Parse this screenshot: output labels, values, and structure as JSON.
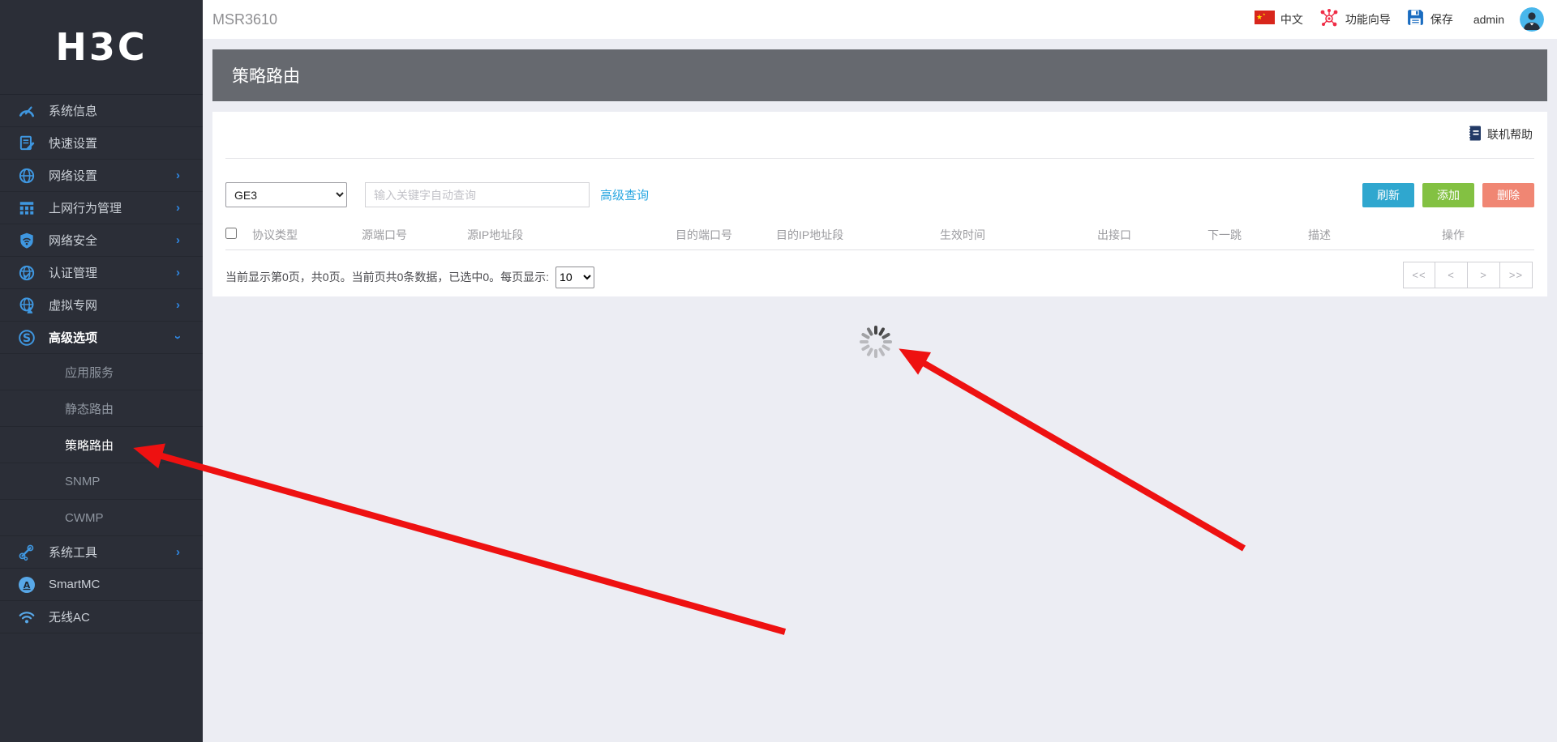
{
  "sidebar": {
    "logo": "H3C",
    "items": [
      {
        "label": "系统信息",
        "icon": "gauge-icon"
      },
      {
        "label": "快速设置",
        "icon": "quick-setup-icon"
      },
      {
        "label": "网络设置",
        "icon": "globe-icon",
        "chevron": "right"
      },
      {
        "label": "上网行为管理",
        "icon": "behavior-icon",
        "chevron": "right"
      },
      {
        "label": "网络安全",
        "icon": "shield-icon",
        "chevron": "right"
      },
      {
        "label": "认证管理",
        "icon": "auth-globe-icon",
        "chevron": "right"
      },
      {
        "label": "虚拟专网",
        "icon": "vpn-globe-icon",
        "chevron": "right"
      },
      {
        "label": "高级选项",
        "icon": "advanced-icon",
        "chevron": "down",
        "expanded": true
      },
      {
        "label": "应用服务",
        "sub": true
      },
      {
        "label": "静态路由",
        "sub": true
      },
      {
        "label": "策略路由",
        "sub": true,
        "selected": true
      },
      {
        "label": "SNMP",
        "sub": true
      },
      {
        "label": "CWMP",
        "sub": true
      },
      {
        "label": "系统工具",
        "icon": "tools-icon",
        "chevron": "right"
      },
      {
        "label": "SmartMC",
        "icon": "smartmc-icon"
      },
      {
        "label": "无线AC",
        "icon": "wifi-icon"
      }
    ]
  },
  "header": {
    "device": "MSR3610",
    "language": "中文",
    "wizard": "功能向导",
    "save": "保存",
    "username": "admin"
  },
  "page": {
    "title": "策略路由",
    "help": "联机帮助"
  },
  "toolbar": {
    "interface_value": "GE3",
    "search_placeholder": "输入关键字自动查询",
    "advanced_query": "高级查询",
    "refresh": "刷新",
    "add": "添加",
    "delete": "删除"
  },
  "table": {
    "columns": [
      "协议类型",
      "源端口号",
      "源IP地址段",
      "目的端口号",
      "目的IP地址段",
      "生效时间",
      "出接口",
      "下一跳",
      "描述",
      "操作"
    ]
  },
  "pagination": {
    "summary": "当前显示第0页，共0页。当前页共0条数据，已选中0。每页显示:",
    "page_size": "10",
    "first": "<<",
    "prev": "<",
    "next": ">",
    "last": ">>"
  },
  "colors": {
    "refresh_button": "#2fa7cf",
    "add_button": "#83c142",
    "delete_button": "#f08673",
    "link": "#2aa7e1",
    "annotation_arrow": "#ee1111",
    "sidebar_bg": "#2b2e37",
    "title_bar_bg": "#66696f"
  },
  "status": {
    "loading": true
  }
}
